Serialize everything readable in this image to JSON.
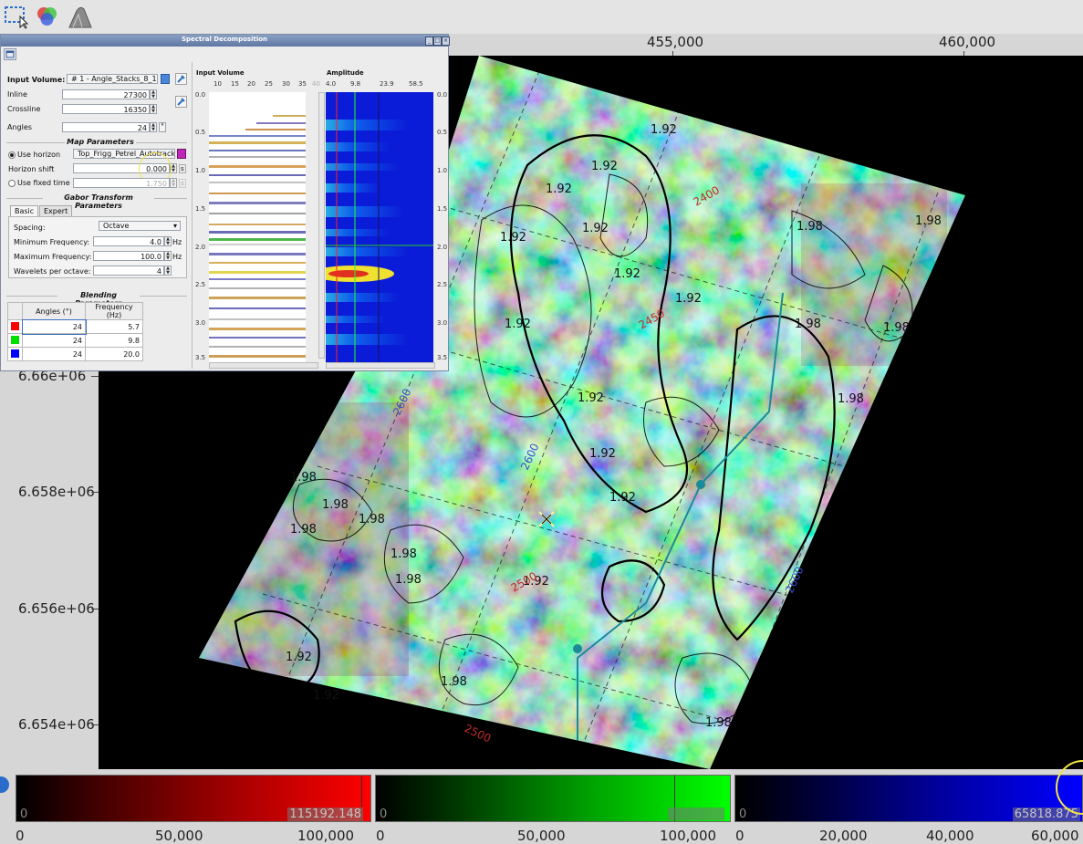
{
  "toolbar": {
    "tools": [
      "selection-rectangle-icon",
      "rgb-blend-icon",
      "surface-icon"
    ]
  },
  "map": {
    "x_ticks": [
      "455,000",
      "460,000"
    ],
    "y_ticks": [
      "6.66e+06",
      "6.658e+06",
      "6.656e+06",
      "6.654e+06"
    ],
    "contour_labels": [
      "1.92",
      "1.98",
      "2400",
      "2450",
      "2500",
      "2600"
    ]
  },
  "dialog": {
    "title": "Spectral Decomposition",
    "input_volume_label": "Input Volume:",
    "input_volume_value": "# 1 - Angle_Stacks_8_16_",
    "inline_label": "Inline",
    "inline_value": "27300",
    "crossline_label": "Crossline",
    "crossline_value": "16350",
    "angles_label": "Angles",
    "angles_value": "24",
    "map_params_title": "Map Parameters",
    "use_horizon_label": "Use horizon",
    "horizon_value": "Top_Frigg_Petrel_Autotrack",
    "horizon_shift_label": "Horizon shift",
    "horizon_shift_value": "0.000",
    "horizon_shift_unit": "s",
    "use_fixed_time_label": "Use fixed time",
    "fixed_time_value": "1.750",
    "fixed_time_unit": "s",
    "gabor_title": "Gabor Transform Parameters",
    "tab_basic": "Basic",
    "tab_expert": "Expert",
    "spacing_label": "Spacing:",
    "spacing_value": "Octave",
    "min_freq_label": "Minimum Frequency:",
    "min_freq_value": "4.0",
    "max_freq_label": "Maximum Frequency:",
    "max_freq_value": "100.0",
    "freq_unit": "Hz",
    "wavelets_label": "Wavelets per octave:",
    "wavelets_value": "4",
    "blending_title": "Blending Parameters",
    "blend_headers": [
      "Angles (°)",
      "Frequency (Hz)"
    ],
    "blend_rows": [
      {
        "color": "#ff0000",
        "angle": "24",
        "freq": "5.7"
      },
      {
        "color": "#00e000",
        "angle": "24",
        "freq": "9.8"
      },
      {
        "color": "#0000ff",
        "angle": "24",
        "freq": "20.0"
      }
    ],
    "seismic_title": "Input Volume",
    "seismic_x_ticks": [
      "10",
      "15",
      "20",
      "25",
      "30",
      "35",
      "40"
    ],
    "amp_title": "Amplitude",
    "amp_x_ticks": [
      "4.0",
      "9.8",
      "23.9",
      "58.5"
    ],
    "time_ticks": [
      "0.0",
      "0.5",
      "1.0",
      "1.5",
      "2.0",
      "2.5",
      "3.0",
      "3.5"
    ]
  },
  "colorbars": [
    {
      "name": "red",
      "color": "#ff0000",
      "min": "0",
      "max": "115192.148",
      "ticks": [
        "0",
        "50,000",
        "100,000"
      ]
    },
    {
      "name": "green",
      "color": "#00ff00",
      "min": "0",
      "max": "",
      "ticks": [
        "0",
        "50,000",
        "100,000"
      ]
    },
    {
      "name": "blue",
      "color": "#0000ff",
      "min": "0",
      "max": "65818.875",
      "ticks": [
        "0",
        "20,000",
        "40,000",
        "60,000"
      ]
    }
  ]
}
